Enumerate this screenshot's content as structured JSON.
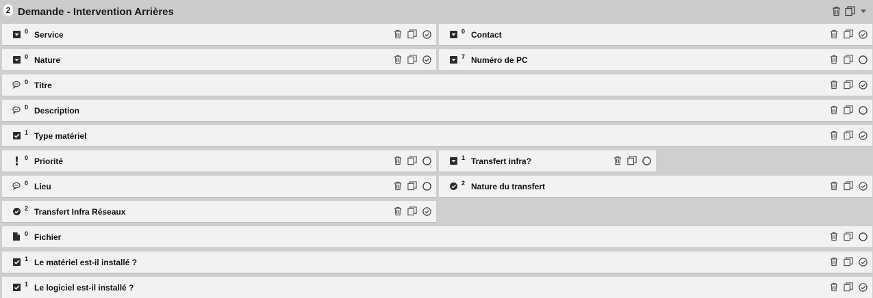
{
  "header": {
    "count": "2",
    "title": "Demande - Intervention Arrières"
  },
  "fields": [
    {
      "id": "service",
      "badge": "0",
      "label": "Service",
      "type": "dropdown",
      "status": "checked"
    },
    {
      "id": "contact",
      "badge": "0",
      "label": "Contact",
      "type": "dropdown",
      "status": "checked"
    },
    {
      "id": "nature",
      "badge": "0",
      "label": "Nature",
      "type": "dropdown",
      "status": "checked"
    },
    {
      "id": "numero-pc",
      "badge": "7",
      "label": "Numéro de PC",
      "type": "dropdown",
      "status": "empty"
    },
    {
      "id": "titre",
      "badge": "0",
      "label": "Titre",
      "type": "comment",
      "status": "checked"
    },
    {
      "id": "description",
      "badge": "0",
      "label": "Description",
      "type": "comment",
      "status": "empty"
    },
    {
      "id": "type-materiel",
      "badge": "1",
      "label": "Type matériel",
      "type": "checkbox",
      "status": "checked"
    },
    {
      "id": "priorite",
      "badge": "0",
      "label": "Priorité",
      "type": "exclamation",
      "status": "empty"
    },
    {
      "id": "transfert-infra",
      "badge": "1",
      "label": "Transfert infra?",
      "type": "dropdown",
      "status": "empty"
    },
    {
      "id": "lieu",
      "badge": "0",
      "label": "Lieu",
      "type": "comment",
      "status": "empty"
    },
    {
      "id": "nature-transfert",
      "badge": "2",
      "label": "Nature du transfert",
      "type": "radio",
      "status": "checked"
    },
    {
      "id": "transfert-infra-reseaux",
      "badge": "2",
      "label": "Transfert Infra Réseaux",
      "type": "radio",
      "status": "checked"
    },
    {
      "id": "fichier",
      "badge": "0",
      "label": "Fichier",
      "type": "file",
      "status": "empty"
    },
    {
      "id": "materiel-installe",
      "badge": "1",
      "label": "Le matériel est-il installé ?",
      "type": "checkbox",
      "status": "checked"
    },
    {
      "id": "logiciel-installe",
      "badge": "1",
      "label": "Le logiciel est-il installé ?",
      "type": "checkbox",
      "status": "checked"
    }
  ],
  "icons": {
    "dropdown": "dropdown-icon",
    "comment": "comment-icon",
    "checkbox": "checkbox-icon",
    "exclamation": "exclamation-icon",
    "radio": "radio-check-icon",
    "file": "file-icon",
    "delete": "trash-icon",
    "copy": "copy-icon",
    "status_checked": "check-circle-icon",
    "status_empty": "empty-circle-icon"
  },
  "colors": {
    "background": "#cfcfcf",
    "card": "#f2f2f2",
    "icon": "#444444"
  }
}
